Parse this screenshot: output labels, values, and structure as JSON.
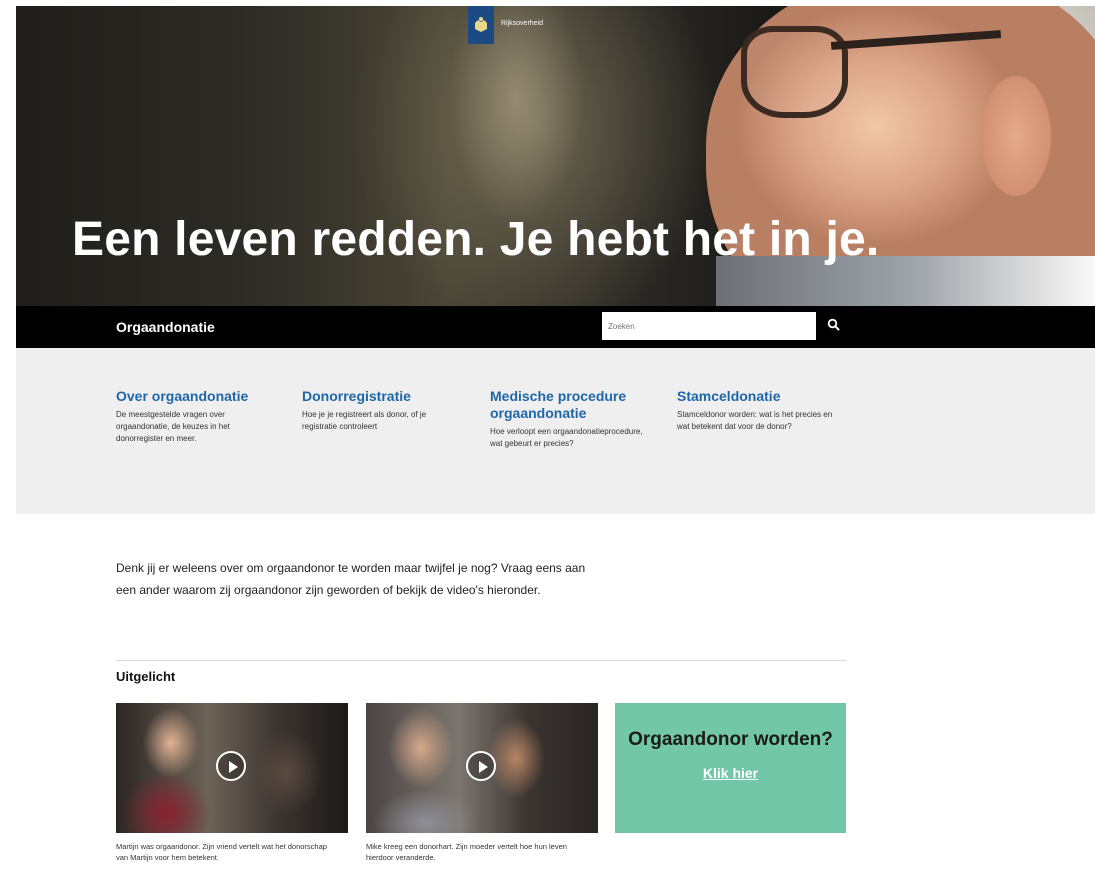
{
  "hero": {
    "logo_text": "Rijksoverheid",
    "title": "Een leven redden. Je hebt het in je."
  },
  "navbar": {
    "site_title": "Orgaandonatie",
    "search_placeholder": "Zoeken",
    "search_icon": "search-icon"
  },
  "quick_links": [
    {
      "title": "Over orgaandonatie",
      "description": "De meestgestelde vragen over orgaandonatie, de keuzes in het donorregister en meer."
    },
    {
      "title": "Donorregistratie",
      "description": "Hoe je je registreert als donor, of je registratie controleert"
    },
    {
      "title": "Medische procedure orgaandonatie",
      "description": "Hoe verloopt een orgaandonatieprocedure, wat gebeurt er precies?"
    },
    {
      "title": "Stamceldonatie",
      "description": "Stamceldonor worden: wat is het precies en wat betekent dat voor de donor?"
    }
  ],
  "intro": "Denk jij er weleens over om orgaandonor te worden maar twijfel je nog? Vraag eens aan een ander waarom zij orgaandonor zijn geworden of bekijk de video's hieronder.",
  "featured": {
    "title": "Uitgelicht",
    "cards": [
      {
        "caption": "Martijn was orgaandonor. Zijn vriend vertelt wat het donorschap van Martijn voor hem betekent.",
        "icon": "play-icon"
      },
      {
        "caption": "Mike kreeg een donorhart. Zijn moeder vertelt hoe hun leven hierdoor veranderde.",
        "icon": "play-icon"
      }
    ],
    "cta": {
      "title": "Orgaandonor worden?",
      "link": "Klik hier",
      "color": "#71c7a7"
    }
  },
  "colors": {
    "link_blue": "#1f66a8",
    "navbar": "#000000",
    "quick_bg": "#efeff0",
    "logo_blue": "#1c4a85"
  }
}
